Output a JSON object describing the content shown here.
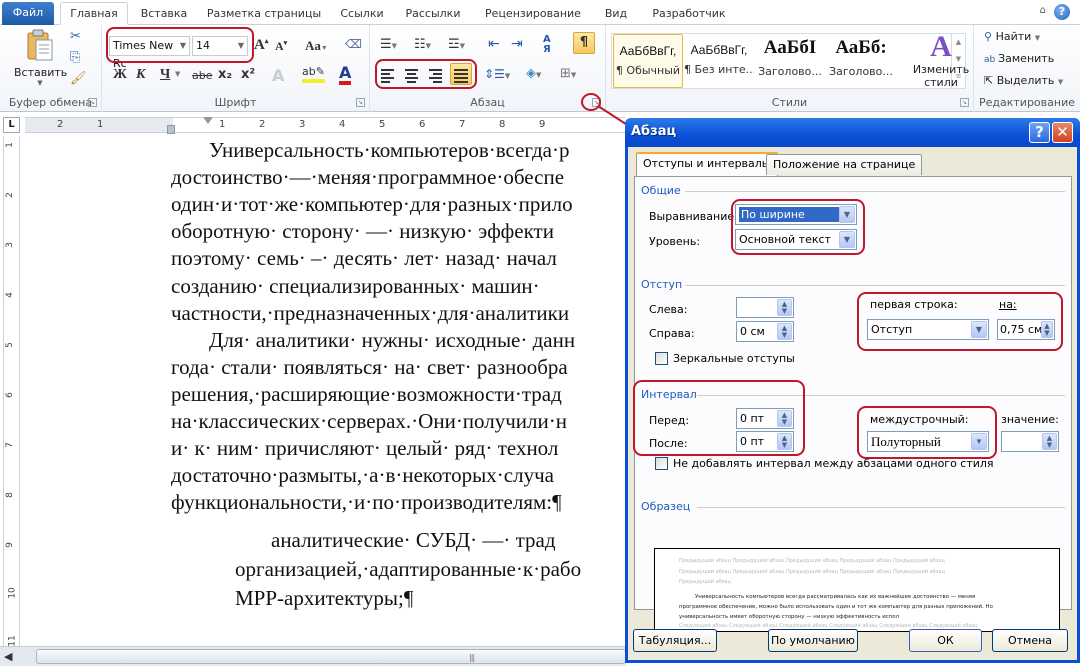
{
  "ribbon": {
    "tabs": [
      {
        "label": "Файл",
        "active": false
      },
      {
        "label": "Главная",
        "active": true
      },
      {
        "label": "Вставка",
        "active": false
      },
      {
        "label": "Разметка страницы",
        "active": false
      },
      {
        "label": "Ссылки",
        "active": false
      },
      {
        "label": "Рассылки",
        "active": false
      },
      {
        "label": "Рецензирование",
        "active": false
      },
      {
        "label": "Вид",
        "active": false
      },
      {
        "label": "Разработчик",
        "active": false
      }
    ],
    "help_icon": "?",
    "clipboard": {
      "label": "Буфер обмена",
      "paste_label": "Вставить",
      "icons": [
        "paste-icon",
        "cut-icon",
        "copy-icon",
        "format-painter-icon"
      ]
    },
    "font": {
      "label": "Шрифт",
      "font_name": "Times New Rc",
      "font_size": "14",
      "bold": "Ж",
      "italic": "К",
      "underline": "Ч",
      "strike": "abe",
      "subscript": "x₂",
      "superscript": "x²",
      "change_case": "Aa",
      "font_color_accent": "#d01b1b",
      "highlight_accent": "#f5ee2a"
    },
    "paragraph": {
      "label": "Абзац",
      "alignment_active": "justify",
      "show_marks": "¶",
      "sort": "А↓Я"
    },
    "styles": {
      "label": "Стили",
      "items": [
        {
          "sample": "АаБбВвГг,",
          "name": "¶ Обычный",
          "selected": true
        },
        {
          "sample": "АаБбВвГг,",
          "name": "¶ Без инте...",
          "selected": false
        },
        {
          "sample": "АаБбІ",
          "name": "Заголово...",
          "selected": false
        },
        {
          "sample": "АаБб:",
          "name": "Заголово...",
          "selected": false
        }
      ],
      "change_styles": "Изменить стили"
    },
    "editing": {
      "label": "Редактирование",
      "find": "Найти",
      "replace": "Заменить",
      "select": "Выделить"
    }
  },
  "ruler": {
    "corner": "L",
    "h_numbers": [
      "2",
      "1",
      "1",
      "2",
      "3",
      "4",
      "5",
      "6",
      "7",
      "8",
      "9"
    ],
    "v_numbers": [
      "1",
      "2",
      "3",
      "4",
      "5",
      "6",
      "7",
      "8",
      "9",
      "10",
      "11"
    ]
  },
  "document": {
    "lines": [
      {
        "text": "Универсальность·компьютеров·всегда·р",
        "style": "indent"
      },
      {
        "text": "достоинство·—·меняя·программное·обеспе",
        "style": "normal"
      },
      {
        "text": "один·и·тот·же·компьютер·для·разных·прило",
        "style": "normal"
      },
      {
        "text": "оборотную·  сторону·  —·  низкую·  эффекти",
        "style": "normal"
      },
      {
        "text": "поэтому·  семь·  –·  десять·  лет·  назад·  начал",
        "style": "normal"
      },
      {
        "text": "созданию·    специализированных·    машин·",
        "style": "normal"
      },
      {
        "text": "частности,·предназначенных·для·аналитики",
        "style": "normal"
      },
      {
        "text": "Для·  аналитики·  нужны·  исходные·  данн",
        "style": "indent"
      },
      {
        "text": "года·  стали·  появляться·  на·  свет·  разнообра",
        "style": "normal"
      },
      {
        "text": "решения,·расширяющие·возможности·трад",
        "style": "normal"
      },
      {
        "text": "на·классических·серверах.·Они·получили·н",
        "style": "normal"
      },
      {
        "text": "и·  к·  ним·  причисляют·  целый·  ряд·  технол",
        "style": "normal"
      },
      {
        "text": "достаточно·размыты,·а·в·некоторых·случа",
        "style": "normal"
      },
      {
        "text": "функциональности,·и·по·производителям:¶",
        "style": "normal"
      },
      {
        "text": "аналитические·  СУБД·  —·  трад",
        "style": "l2i"
      },
      {
        "text": "организацией,·адаптированные·к·рабо",
        "style": "l2"
      },
      {
        "text": "МРР-архитектуры;¶",
        "style": "l2"
      }
    ]
  },
  "dialog": {
    "title": "Абзац",
    "help": "?",
    "close": "✕",
    "tabs": [
      {
        "label": "Отступы и интервалы",
        "active": true
      },
      {
        "label": "Положение на странице",
        "active": false
      }
    ],
    "general": {
      "section": "Общие",
      "alignment_label": "Выравнивание:",
      "alignment_value": "По ширине",
      "level_label": "Уровень:",
      "level_value": "Основной текст"
    },
    "indent": {
      "section": "Отступ",
      "left_label": "Слева:",
      "left_value": "",
      "right_label": "Справа:",
      "right_value": "0 см",
      "first_line_label": "первая строка:",
      "first_line_value": "Отступ",
      "by_label": "на:",
      "by_value": "0,75 см",
      "mirror_label": "Зеркальные отступы",
      "mirror_checked": false
    },
    "spacing": {
      "section": "Интервал",
      "before_label": "Перед:",
      "before_value": "0 пт",
      "after_label": "После:",
      "after_value": "0 пт",
      "line_label": "междустрочный:",
      "line_value": "Полуторный",
      "at_label": "значение:",
      "at_value": "",
      "no_space_label": "Не добавлять интервал между абзацами одного стиля",
      "no_space_checked": false
    },
    "preview": {
      "section": "Образец",
      "prev_lines": [
        "Предыдущий абзац Предыдущий абзац Предыдущий абзац Предыдущий абзац Предыдущий абзац",
        "Предыдущий абзац Предыдущий абзац Предыдущий абзац Предыдущий абзац Предыдущий абзац",
        "Предыдущий абзац"
      ],
      "main_lines": [
        "Универсальность компьютеров всегда рассматривалась как их важнейшее достоинство — меняя",
        "программное обеспечение, можно было использовать один и тот же компьютер для разных приложений. Но",
        "универсальность имеет оборотную сторону — низкую эффективность испол"
      ],
      "next_lines": [
        "Следующий абзац Следующий абзац Следующий абзац Следующий абзац Следующий абзац Следующий абзац"
      ]
    },
    "buttons": {
      "tabs": "Табуляция...",
      "default": "По умолчанию",
      "ok": "ОК",
      "cancel": "Отмена"
    }
  },
  "colors": {
    "annotation_red": "#c0182a",
    "dialog_title_blue": "#0a4fd6",
    "section_blue": "#1e5bc0"
  }
}
